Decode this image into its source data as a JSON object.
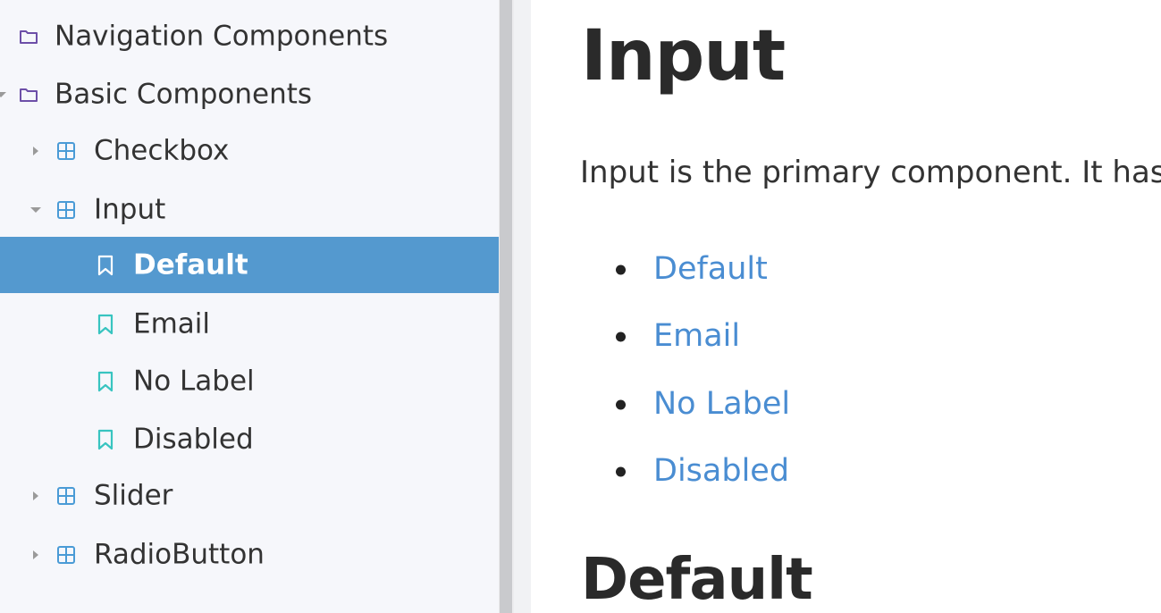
{
  "sidebar": {
    "items": [
      {
        "label": "Navigation Components",
        "kind": "folder",
        "icon": "folder-icon",
        "expanded": false
      },
      {
        "label": "Basic Components",
        "kind": "folder",
        "icon": "folder-icon",
        "expanded": true
      },
      {
        "label": "Checkbox",
        "kind": "component",
        "icon": "component-icon",
        "expanded": false
      },
      {
        "label": "Input",
        "kind": "component",
        "icon": "component-icon",
        "expanded": true
      },
      {
        "label": "Default",
        "kind": "story",
        "icon": "bookmark-icon",
        "selected": true
      },
      {
        "label": "Email",
        "kind": "story",
        "icon": "bookmark-icon"
      },
      {
        "label": "No Label",
        "kind": "story",
        "icon": "bookmark-icon"
      },
      {
        "label": "Disabled",
        "kind": "story",
        "icon": "bookmark-icon"
      },
      {
        "label": "Slider",
        "kind": "component",
        "icon": "component-icon",
        "expanded": false
      },
      {
        "label": "RadioButton",
        "kind": "component",
        "icon": "component-icon",
        "expanded": false
      }
    ]
  },
  "main": {
    "title": "Input",
    "intro": "Input is the primary component. It has",
    "stories": [
      "Default",
      "Email",
      "No Label",
      "Disabled"
    ],
    "section_heading": "Default"
  },
  "colors": {
    "selected_bg": "#5499cf",
    "link": "#4a8dd2",
    "folder_icon": "#6d4fa8",
    "component_icon": "#4a9bd6",
    "story_icon": "#38c4c0"
  }
}
